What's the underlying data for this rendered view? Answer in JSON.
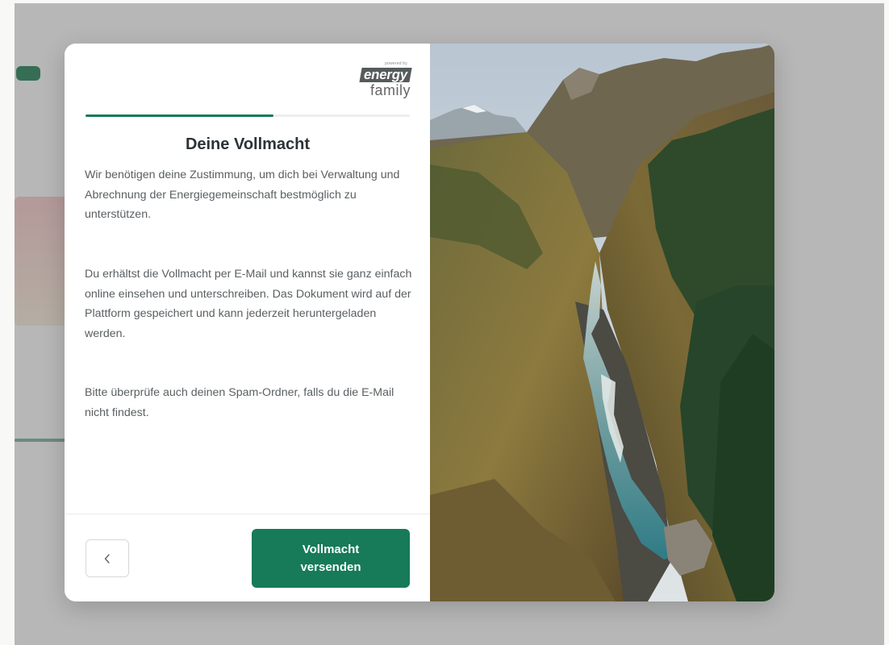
{
  "brand": {
    "powered_by": "powered by",
    "word1": "energy",
    "word2": "family"
  },
  "progress": {
    "fraction": 0.58,
    "color": "#177a58"
  },
  "dialog": {
    "title": "Deine Vollmacht",
    "paragraph1": "Wir benötigen deine Zustimmung, um dich bei Verwaltung und Abrechnung der Energiegemeinschaft bestmöglich zu unterstützen.",
    "paragraph2": "Du erhältst die Vollmacht per E-Mail und kannst sie ganz einfach online einsehen und unterschreiben. Das Dokument wird auf der Plattform gespeichert und kann jederzeit heruntergeladen werden.",
    "paragraph3": "Bitte überprüfe auch deinen Spam-Ordner, falls du die E-Mail nicht findest."
  },
  "buttons": {
    "back_icon": "chevron-left-icon",
    "primary_label": "Vollmacht versenden"
  },
  "colors": {
    "accent": "#177a58",
    "text": "#2b3338"
  },
  "image": {
    "subject": "mountain-stream-photo"
  }
}
